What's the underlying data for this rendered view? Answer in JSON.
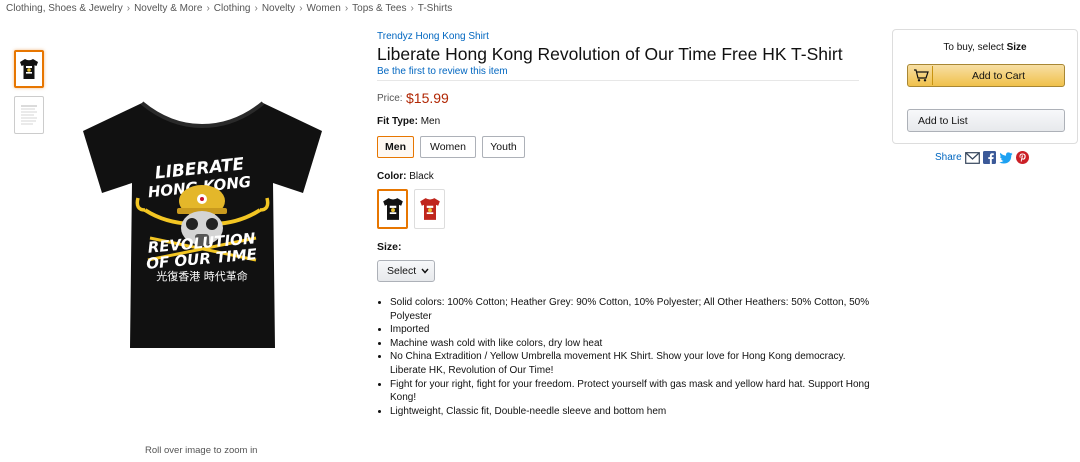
{
  "breadcrumb": [
    "Clothing, Shoes & Jewelry",
    "Novelty & More",
    "Clothing",
    "Novelty",
    "Women",
    "Tops & Tees",
    "T-Shirts"
  ],
  "breadcrumb_separator": "›",
  "gallery": {
    "thumbnails": [
      "black-tshirt-thumb",
      "size-chart-thumb"
    ],
    "zoom_hint": "Roll over image to zoom in",
    "shirt_text_line1": "LIBERATE",
    "shirt_text_line2": "HONG KONG",
    "shirt_text_line3": "REVOLUTION",
    "shirt_text_line4": "OF OUR TIME",
    "shirt_text_chinese": "光復香港 時代革命"
  },
  "product": {
    "brand": "Trendyz Hong Kong Shirt",
    "title": "Liberate Hong Kong Revolution of Our Time Free HK T-Shirt",
    "review_link": "Be the first to review this item",
    "price_label": "Price:",
    "price": "$15.99",
    "fit_type_label": "Fit Type:",
    "fit_type_value": "Men",
    "fit_options": [
      "Men",
      "Women",
      "Youth"
    ],
    "color_label": "Color:",
    "color_value": "Black",
    "color_swatches": [
      "black",
      "red"
    ],
    "size_label": "Size:",
    "size_select": "Select",
    "bullets": [
      "Solid colors: 100% Cotton; Heather Grey: 90% Cotton, 10% Polyester; All Other Heathers: 50% Cotton, 50% Polyester",
      "Imported",
      "Machine wash cold with like colors, dry low heat",
      "No China Extradition / Yellow Umbrella movement HK Shirt. Show your love for Hong Kong democracy. Liberate HK, Revolution of Our Time!",
      "Fight for your right, fight for your freedom. Protect yourself with gas mask and yellow hard hat. Support Hong Kong!",
      "Lightweight, Classic fit, Double-needle sleeve and bottom hem"
    ]
  },
  "buybox": {
    "prompt_prefix": "To buy, select ",
    "prompt_bold": "Size",
    "add_to_cart": "Add to Cart",
    "add_to_list": "Add to List"
  },
  "share": {
    "label": "Share",
    "icons": [
      "email-icon",
      "facebook-icon",
      "twitter-icon",
      "pinterest-icon"
    ]
  },
  "colors": {
    "link": "#0066c0",
    "price": "#b12704",
    "selected_border": "#e77600",
    "cart_button": "#f0c14b",
    "shirt_black": "#111111",
    "shirt_red": "#c0261d"
  }
}
